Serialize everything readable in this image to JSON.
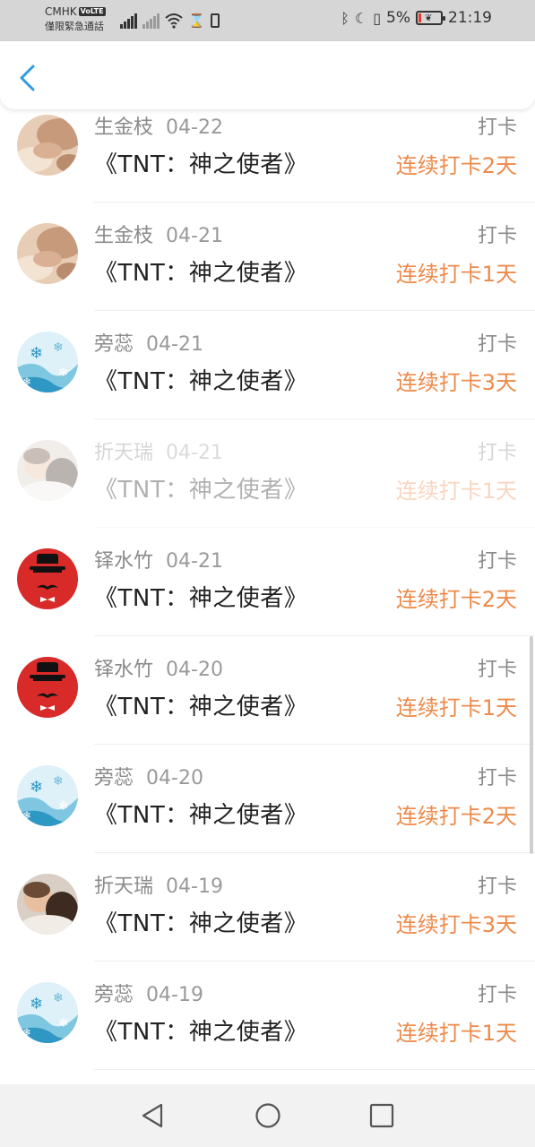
{
  "status_bar": {
    "carrier": "CMHK",
    "volte": "VoLTE",
    "emergency": "僅限緊急通話",
    "battery": "5%",
    "time": "21:19"
  },
  "header": {
    "back_icon": "chevron-left-icon"
  },
  "entries": [
    {
      "name": "生金枝",
      "date": "04-22",
      "book": "《TNT：神之使者》",
      "tag": "打卡",
      "streak": "连续打卡2天",
      "avatar": "photo-hands"
    },
    {
      "name": "生金枝",
      "date": "04-21",
      "book": "《TNT：神之使者》",
      "tag": "打卡",
      "streak": "连续打卡1天",
      "avatar": "photo-hands"
    },
    {
      "name": "旁蕊",
      "date": "04-21",
      "book": "《TNT：神之使者》",
      "tag": "打卡",
      "streak": "连续打卡3天",
      "avatar": "snowflake"
    },
    {
      "name": "折天瑞",
      "date": "04-21",
      "book": "《TNT：神之使者》",
      "tag": "打卡",
      "streak": "连续打卡1天",
      "avatar": "photo-baby",
      "faded": true
    },
    {
      "name": "铎水竹",
      "date": "04-21",
      "book": "《TNT：神之使者》",
      "tag": "打卡",
      "streak": "连续打卡2天",
      "avatar": "gentleman"
    },
    {
      "name": "铎水竹",
      "date": "04-20",
      "book": "《TNT：神之使者》",
      "tag": "打卡",
      "streak": "连续打卡1天",
      "avatar": "gentleman"
    },
    {
      "name": "旁蕊",
      "date": "04-20",
      "book": "《TNT：神之使者》",
      "tag": "打卡",
      "streak": "连续打卡2天",
      "avatar": "snowflake"
    },
    {
      "name": "折天瑞",
      "date": "04-19",
      "book": "《TNT：神之使者》",
      "tag": "打卡",
      "streak": "连续打卡3天",
      "avatar": "photo-baby"
    },
    {
      "name": "旁蕊",
      "date": "04-19",
      "book": "《TNT：神之使者》",
      "tag": "打卡",
      "streak": "连续打卡1天",
      "avatar": "snowflake"
    }
  ],
  "colors": {
    "accent": "#2f9be5",
    "streak": "#ee8a4a",
    "name": "#8a8a8a",
    "title": "#222222"
  },
  "nav": {
    "back": "triangle-back-icon",
    "home": "circle-home-icon",
    "recents": "square-recents-icon"
  }
}
